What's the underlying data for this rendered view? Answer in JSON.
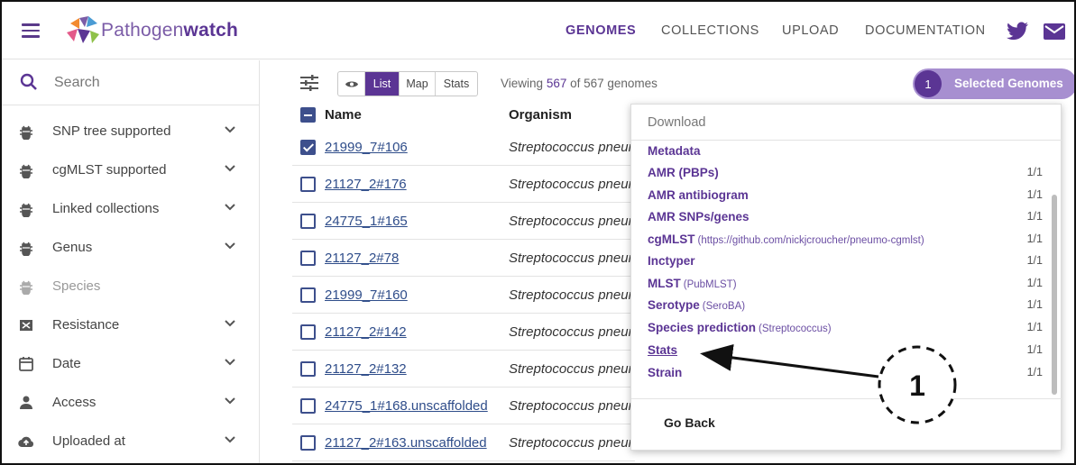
{
  "header": {
    "brand_prefix": "Pathogen",
    "brand_suffix": "watch",
    "nav": [
      {
        "label": "GENOMES",
        "active": true
      },
      {
        "label": "COLLECTIONS",
        "active": false
      },
      {
        "label": "UPLOAD",
        "active": false
      },
      {
        "label": "DOCUMENTATION",
        "active": false
      }
    ],
    "icons": [
      "twitter-icon",
      "mail-icon"
    ]
  },
  "sidebar": {
    "search_placeholder": "Search",
    "filters": [
      {
        "label": "SNP tree supported",
        "icon": "bug-icon",
        "expandable": true,
        "disabled": false
      },
      {
        "label": "cgMLST supported",
        "icon": "bug-icon",
        "expandable": true,
        "disabled": false
      },
      {
        "label": "Linked collections",
        "icon": "bug-icon",
        "expandable": true,
        "disabled": false
      },
      {
        "label": "Genus",
        "icon": "bug-icon",
        "expandable": true,
        "disabled": false
      },
      {
        "label": "Species",
        "icon": "bug-icon",
        "expandable": false,
        "disabled": true
      },
      {
        "label": "Resistance",
        "icon": "resistance-icon",
        "expandable": true,
        "disabled": false
      },
      {
        "label": "Date",
        "icon": "calendar-icon",
        "expandable": true,
        "disabled": false
      },
      {
        "label": "Access",
        "icon": "person-icon",
        "expandable": true,
        "disabled": false
      },
      {
        "label": "Uploaded at",
        "icon": "cloud-icon",
        "expandable": true,
        "disabled": false
      }
    ]
  },
  "toolbar": {
    "views": [
      "List",
      "Map",
      "Stats"
    ],
    "active_view": "List",
    "viewing_prefix": "Viewing",
    "viewing_count": "567",
    "viewing_suffix": "of 567 genomes",
    "selected_count": "1",
    "selected_label": "Selected Genomes"
  },
  "table": {
    "columns": [
      "Name",
      "Organism"
    ],
    "rows": [
      {
        "name": "21999_7#106",
        "organism": "Streptococcus pneumoniae",
        "checked": true
      },
      {
        "name": "21127_2#176",
        "organism": "Streptococcus pneumoniae",
        "checked": false
      },
      {
        "name": "24775_1#165",
        "organism": "Streptococcus pneumoniae",
        "checked": false
      },
      {
        "name": "21127_2#78",
        "organism": "Streptococcus pneumoniae",
        "checked": false
      },
      {
        "name": "21999_7#160",
        "organism": "Streptococcus pneumoniae",
        "checked": false
      },
      {
        "name": "21127_2#142",
        "organism": "Streptococcus pneumoniae",
        "checked": false
      },
      {
        "name": "21127_2#132",
        "organism": "Streptococcus pneumoniae",
        "checked": false
      },
      {
        "name": "24775_1#168.unscaffolded",
        "organism": "Streptococcus pneumoniae",
        "checked": false
      },
      {
        "name": "21127_2#163.unscaffolded",
        "organism": "Streptococcus pneumoniae",
        "checked": false
      }
    ]
  },
  "download": {
    "title": "Download",
    "items": [
      {
        "label": "Metadata",
        "sub": "",
        "count": ""
      },
      {
        "label": "AMR (PBPs)",
        "sub": "",
        "count": "1/1"
      },
      {
        "label": "AMR antibiogram",
        "sub": "",
        "count": "1/1"
      },
      {
        "label": "AMR SNPs/genes",
        "sub": "",
        "count": "1/1"
      },
      {
        "label": "cgMLST",
        "sub": "(https://github.com/nickjcroucher/pneumo-cgmlst)",
        "count": "1/1"
      },
      {
        "label": "Inctyper",
        "sub": "",
        "count": "1/1"
      },
      {
        "label": "MLST",
        "sub": "(PubMLST)",
        "count": "1/1"
      },
      {
        "label": "Serotype",
        "sub": "(SeroBA)",
        "count": "1/1"
      },
      {
        "label": "Species prediction",
        "sub": "(Streptococcus)",
        "count": "1/1"
      },
      {
        "label": "Stats",
        "sub": "",
        "count": "1/1"
      },
      {
        "label": "Strain",
        "sub": "",
        "count": "1/1"
      }
    ],
    "go_back": "Go Back"
  },
  "annotation": {
    "marker": "1"
  },
  "colors": {
    "brand": "#5b3594",
    "brand_light": "#a78fd0",
    "link": "#2f4d8a"
  }
}
